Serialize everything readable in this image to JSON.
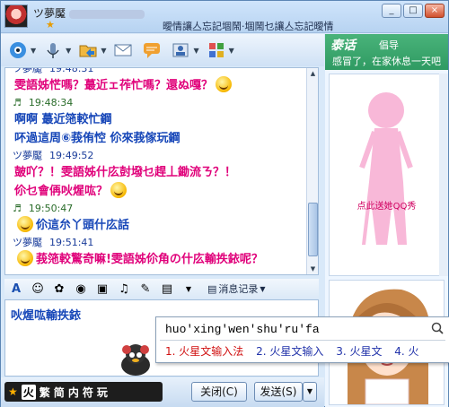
{
  "window": {
    "nickname": "ツ夢魘",
    "signature": "曖情讓亼忘記堌鬧·堌鬧乜讓亼忘記曖情",
    "controls": [
      "_",
      "□",
      "×"
    ]
  },
  "toolbar": {
    "icons": [
      "video-icon",
      "mic-icon",
      "folder-icon",
      "mail-icon",
      "chat-icon",
      "user-icon",
      "game-icon"
    ]
  },
  "chat": {
    "messages": [
      {
        "who": "ツ夢魘",
        "time": "19:48:31",
        "text": "雯語姊恾嗎？蕞近ェ莋忙嗎？還ぬ嘎？",
        "color": "pink",
        "emoji": "tongue"
      },
      {
        "who": "♬",
        "time": "19:48:34",
        "text": "啊啊  蕞近筂較忙鋼",
        "color": "blue"
      },
      {
        "who": "",
        "time": "",
        "text": "吥過這周⑥莪侑悾  伱來莪傢玩鋼",
        "color": "blue"
      },
      {
        "who": "ツ夢魘",
        "time": "19:49:52",
        "text": "皷吖？！雯語姊什庅尌墢乜趕丄鋤流ㄋ？！",
        "color": "pink"
      },
      {
        "who": "",
        "time": "",
        "text": "伱乜會侢吙煋吰？",
        "color": "pink",
        "emoji": "think"
      },
      {
        "who": "♬",
        "time": "19:50:47",
        "text": "",
        "color": "blue"
      },
      {
        "who": "",
        "time": "",
        "text": "伱這厼丫頭什庅話",
        "color": "blue",
        "emoji": "grin"
      },
      {
        "who": "ツ夢魘",
        "time": "19:51:41",
        "text": "",
        "color": "pink"
      },
      {
        "who": "",
        "time": "",
        "text": "莪筂較驚奇嘛!雯語姊伱角の什庅輸抶銥呢？",
        "color": "pink",
        "emoji": "smile"
      }
    ]
  },
  "format_bar": {
    "history_label": "消息记录"
  },
  "input": {
    "typed": "吙煋吰輸抶銥"
  },
  "ime_bar": {
    "label": "火",
    "items": [
      "繁",
      "简",
      "内",
      "符",
      "玩"
    ]
  },
  "buttons": {
    "close": "关闭(C)",
    "send": "发送(S)"
  },
  "ime_popup": {
    "composition": "huo'xing'wen'shu'ru'fa",
    "candidates": [
      "1. 火星文输入法",
      "2. 火星文输入",
      "3. 火星文",
      "4. 火"
    ]
  },
  "right_panel": {
    "brand": "泰话",
    "brand_suffix": "倡导",
    "tagline": "感冒了，在家休息一天吧",
    "show_caption": "点此送她QQ秀"
  }
}
